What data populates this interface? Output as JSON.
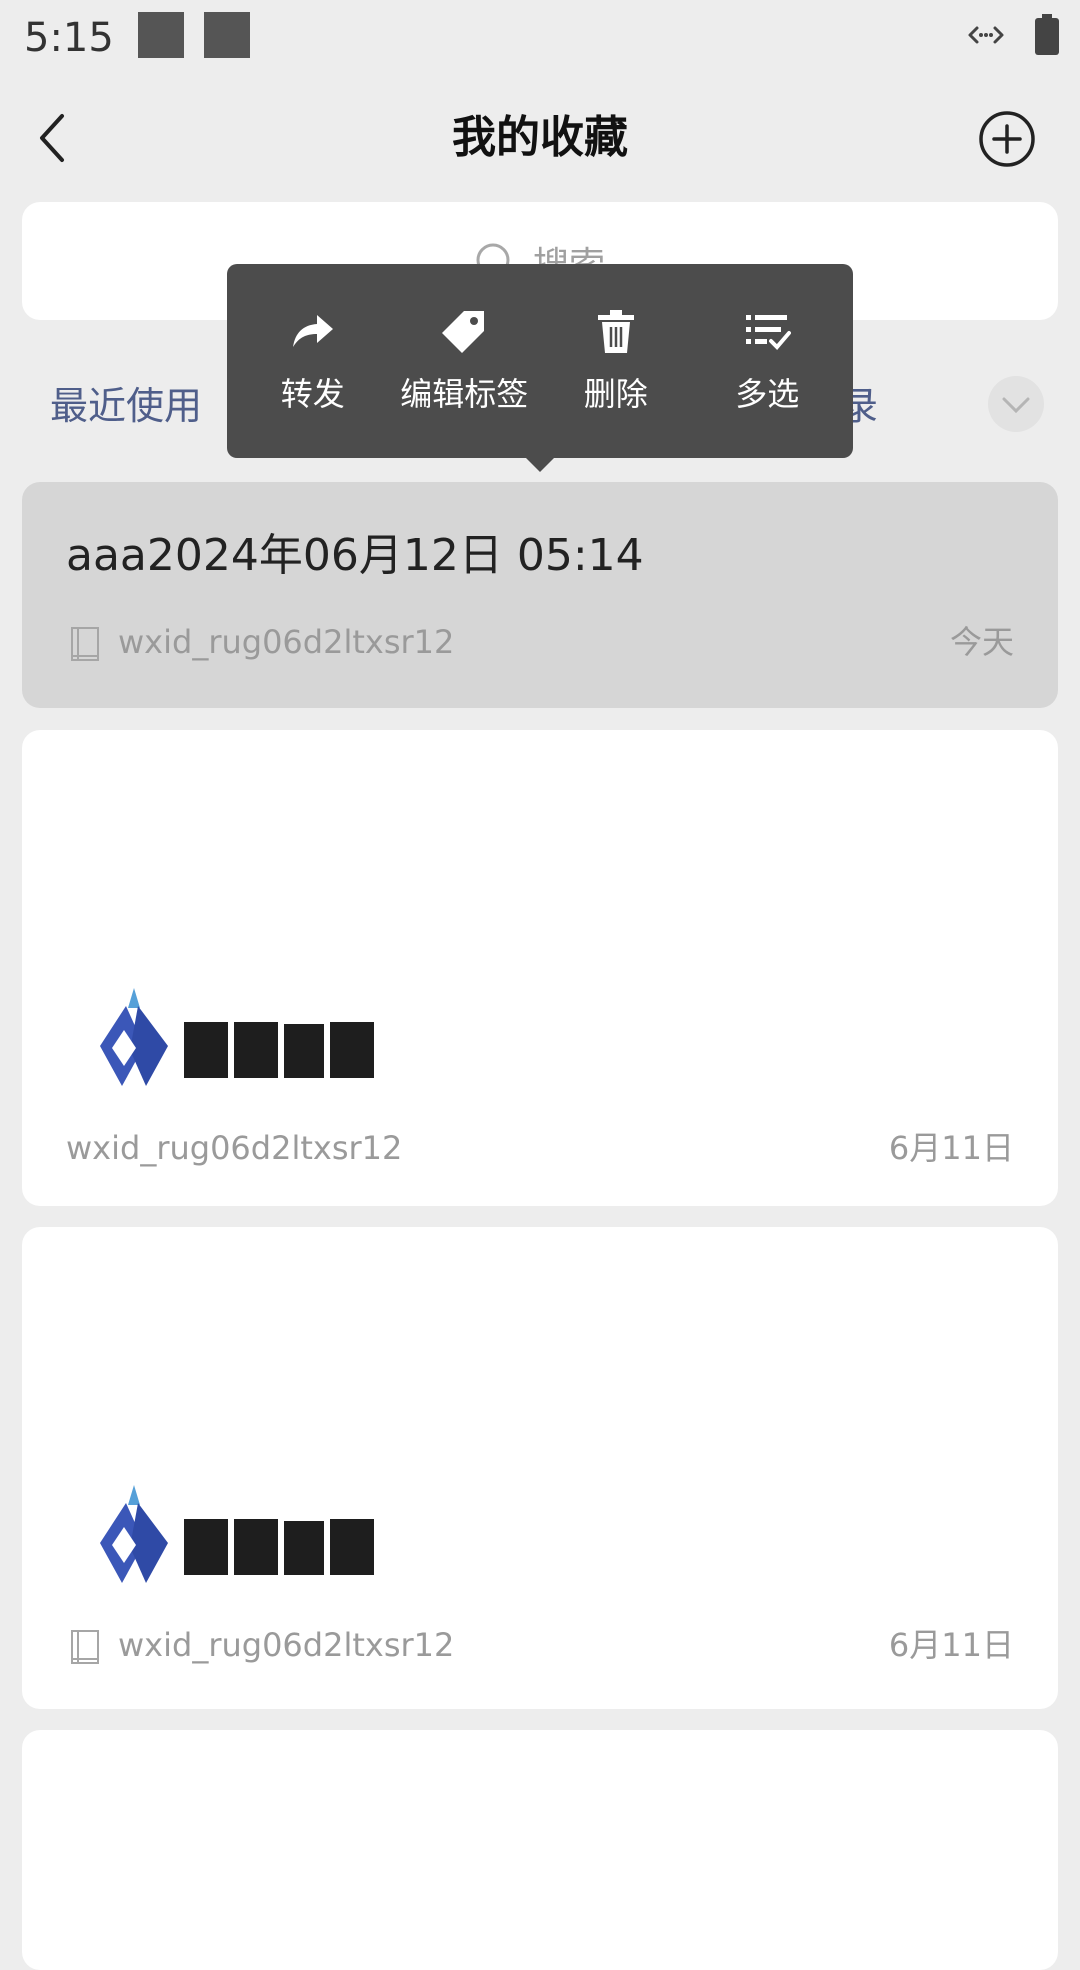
{
  "status_bar": {
    "time": "5:15"
  },
  "header": {
    "title": "我的收藏"
  },
  "search": {
    "placeholder": "搜索"
  },
  "filters": {
    "recent": "最近使用",
    "partial_right": "录"
  },
  "popup_menu": {
    "items": [
      {
        "label": "转发",
        "icon": "forward-icon"
      },
      {
        "label": "编辑标签",
        "icon": "tag-icon"
      },
      {
        "label": "删除",
        "icon": "trash-icon"
      },
      {
        "label": "多选",
        "icon": "multiselect-icon"
      }
    ]
  },
  "favorites": [
    {
      "title": "aaa2024年06月12日 05:14",
      "source": "wxid_rug06d2ltxsr12",
      "date": "今天",
      "selected": true,
      "icon": "note-icon"
    },
    {
      "source": "wxid_rug06d2ltxsr12",
      "date": "6月11日",
      "image_icon": "logo-image"
    },
    {
      "source": "wxid_rug06d2ltxsr12",
      "date": "6月11日",
      "image_icon": "logo-image",
      "icon": "note-icon"
    }
  ],
  "colors": {
    "accent_text": "#4f5e8a",
    "popup_bg": "#4c4c4c",
    "selected_card": "#d6d6d6"
  }
}
